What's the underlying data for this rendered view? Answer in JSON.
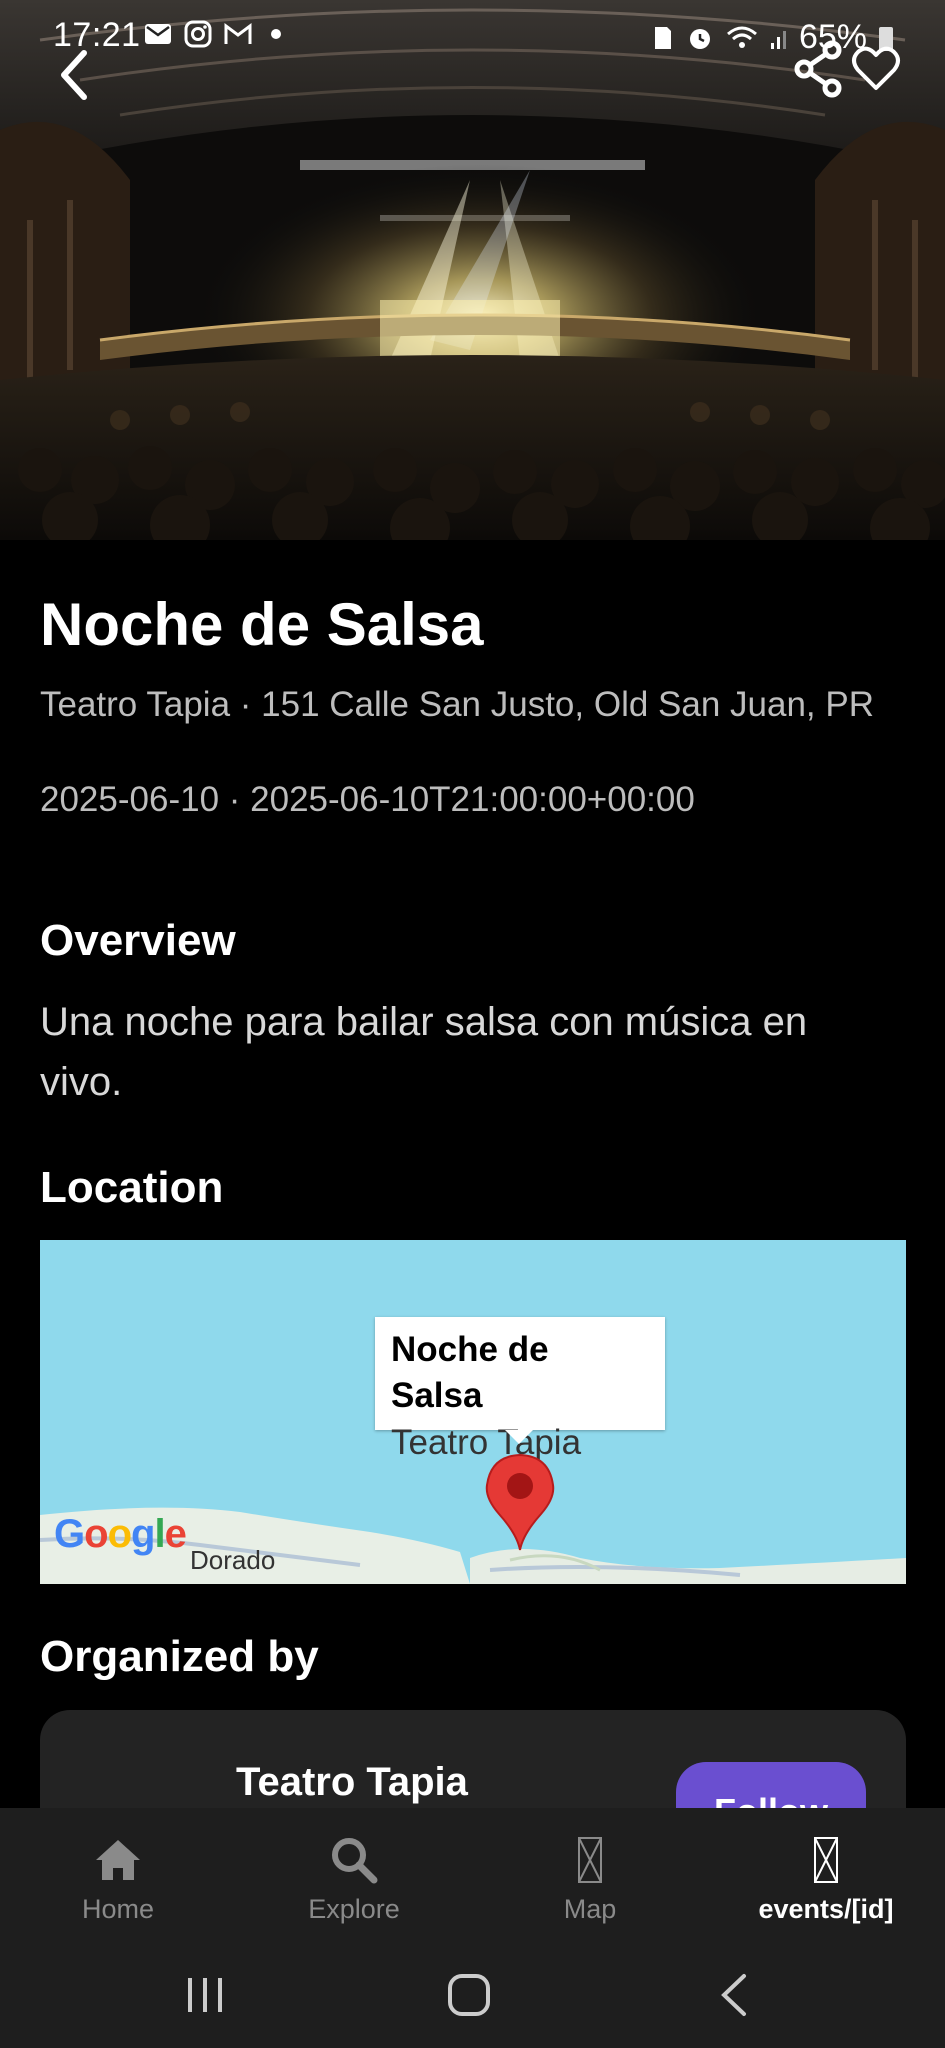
{
  "status_bar": {
    "time": "17:21",
    "battery": "65%"
  },
  "event": {
    "title": "Noche de Salsa",
    "address": "Teatro Tapia · 151 Calle San Justo, Old San Juan, PR",
    "datetime": "2025-06-10 · 2025-06-10T21:00:00+00:00"
  },
  "overview": {
    "heading": "Overview",
    "text": "Una noche para bailar salsa con música en vivo."
  },
  "location": {
    "heading": "Location",
    "callout_title": "Noche de Salsa",
    "callout_subtitle": "Teatro Tapia",
    "map_place_label": "Dorado",
    "map_logo": "Google"
  },
  "organizer": {
    "heading": "Organized by",
    "name": "Teatro Tapia",
    "follow_label": "Follow"
  },
  "tabs": [
    {
      "label": "Home",
      "icon": "home-icon"
    },
    {
      "label": "Explore",
      "icon": "search-icon"
    },
    {
      "label": "Map",
      "icon": "placeholder-icon"
    },
    {
      "label": "events/[id]",
      "icon": "placeholder-icon"
    }
  ],
  "colors": {
    "accent": "#6a4fd0",
    "map_water": "#8fd9ec",
    "pin": "#e53935"
  }
}
